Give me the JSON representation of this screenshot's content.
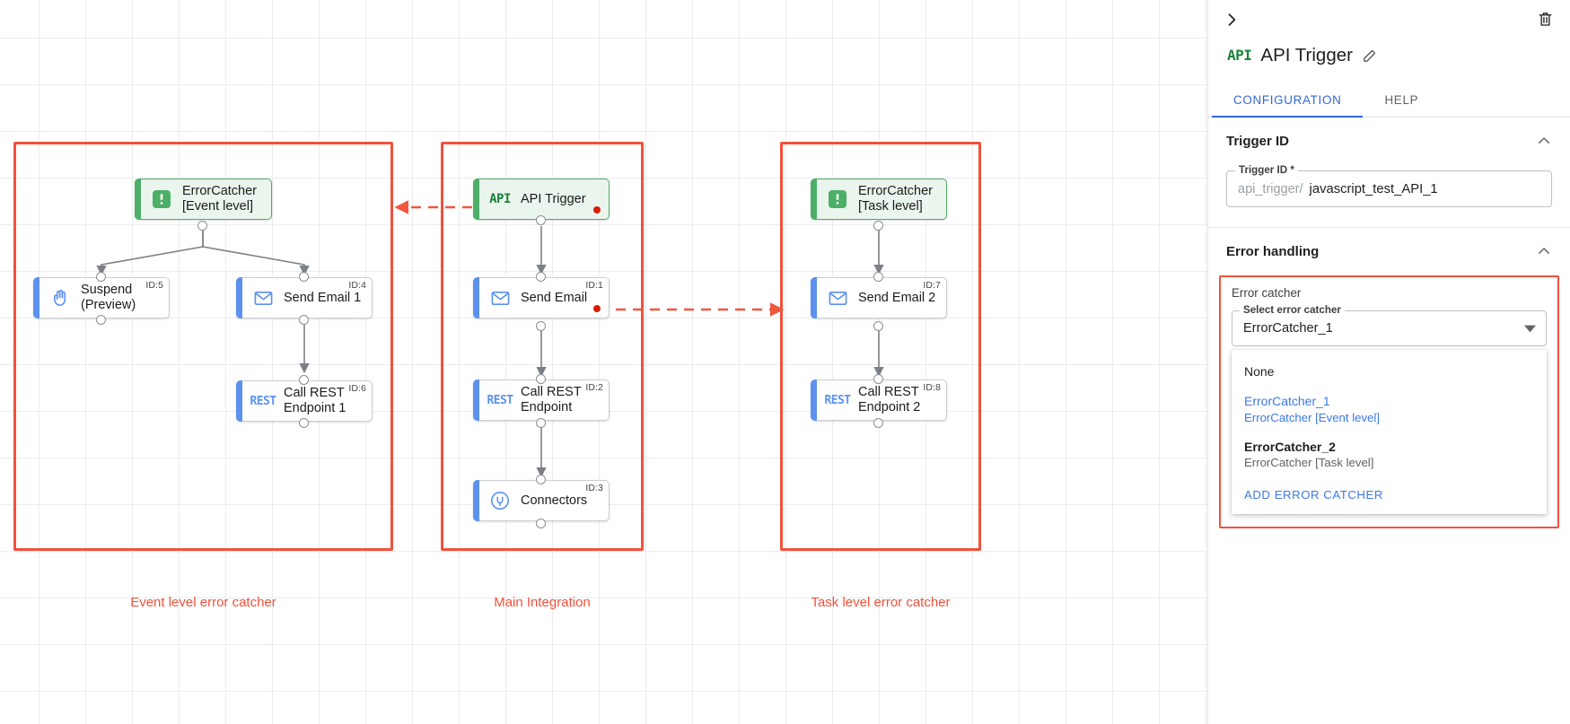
{
  "canvas": {
    "groups": [
      {
        "label": "Event level error catcher"
      },
      {
        "label": "Main Integration"
      },
      {
        "label": "Task level error catcher"
      }
    ],
    "nodes": {
      "error_catcher_event": {
        "label": "ErrorCatcher\n[Event level]",
        "icon": "error-catcher-icon",
        "id_badge": ""
      },
      "suspend": {
        "label": "Suspend\n(Preview)",
        "icon": "hand-icon",
        "id_badge": "ID:5"
      },
      "send_email_1": {
        "label": "Send Email 1",
        "icon": "envelope-icon",
        "id_badge": "ID:4"
      },
      "call_rest_1": {
        "label": "Call REST\nEndpoint 1",
        "icon": "rest-icon",
        "id_badge": "ID:6"
      },
      "api_trigger": {
        "label": "API Trigger",
        "icon": "api-icon",
        "id_badge": ""
      },
      "send_email": {
        "label": "Send Email",
        "icon": "envelope-icon",
        "id_badge": "ID:1"
      },
      "call_rest": {
        "label": "Call REST\nEndpoint",
        "icon": "rest-icon",
        "id_badge": "ID:2"
      },
      "connectors": {
        "label": "Connectors",
        "icon": "connectors-icon",
        "id_badge": "ID:3"
      },
      "error_catcher_task": {
        "label": "ErrorCatcher\n[Task level]",
        "icon": "error-catcher-icon",
        "id_badge": ""
      },
      "send_email_2": {
        "label": "Send Email 2",
        "icon": "envelope-icon",
        "id_badge": "ID:7"
      },
      "call_rest_2": {
        "label": "Call REST\nEndpoint 2",
        "icon": "rest-icon",
        "id_badge": "ID:8"
      }
    },
    "icon_text": {
      "api": "API",
      "rest": "REST"
    },
    "colors": {
      "group_border": "#f0513c",
      "node_accent": "#5b92f0",
      "trigger_accent": "#4caf67",
      "error_dot": "#d81e05"
    }
  },
  "panel": {
    "collapse_icon": "chevron-right-icon",
    "delete_icon": "trash-icon",
    "title": "API Trigger",
    "title_icon": "api-icon",
    "edit_icon": "pencil-icon",
    "tabs": [
      {
        "label": "CONFIGURATION",
        "active": true
      },
      {
        "label": "HELP",
        "active": false
      }
    ],
    "trigger_id_section": {
      "heading": "Trigger ID",
      "collapse_icon": "chevron-up-icon",
      "field_legend": "Trigger ID *",
      "field_prefix": "api_trigger/",
      "field_value": "javascript_test_API_1"
    },
    "error_handling_section": {
      "heading": "Error handling",
      "collapse_icon": "chevron-up-icon",
      "error_catcher_label": "Error catcher",
      "select_legend": "Select error catcher",
      "select_value": "ErrorCatcher_1",
      "dropdown_icon": "chevron-down-icon",
      "options": [
        {
          "title": "None",
          "subtitle": "",
          "selected": false
        },
        {
          "title": "ErrorCatcher_1",
          "subtitle": "ErrorCatcher [Event level]",
          "selected": true
        },
        {
          "title": "ErrorCatcher_2",
          "subtitle": "ErrorCatcher [Task level]",
          "selected": false
        }
      ],
      "add_action": "ADD ERROR CATCHER"
    }
  }
}
